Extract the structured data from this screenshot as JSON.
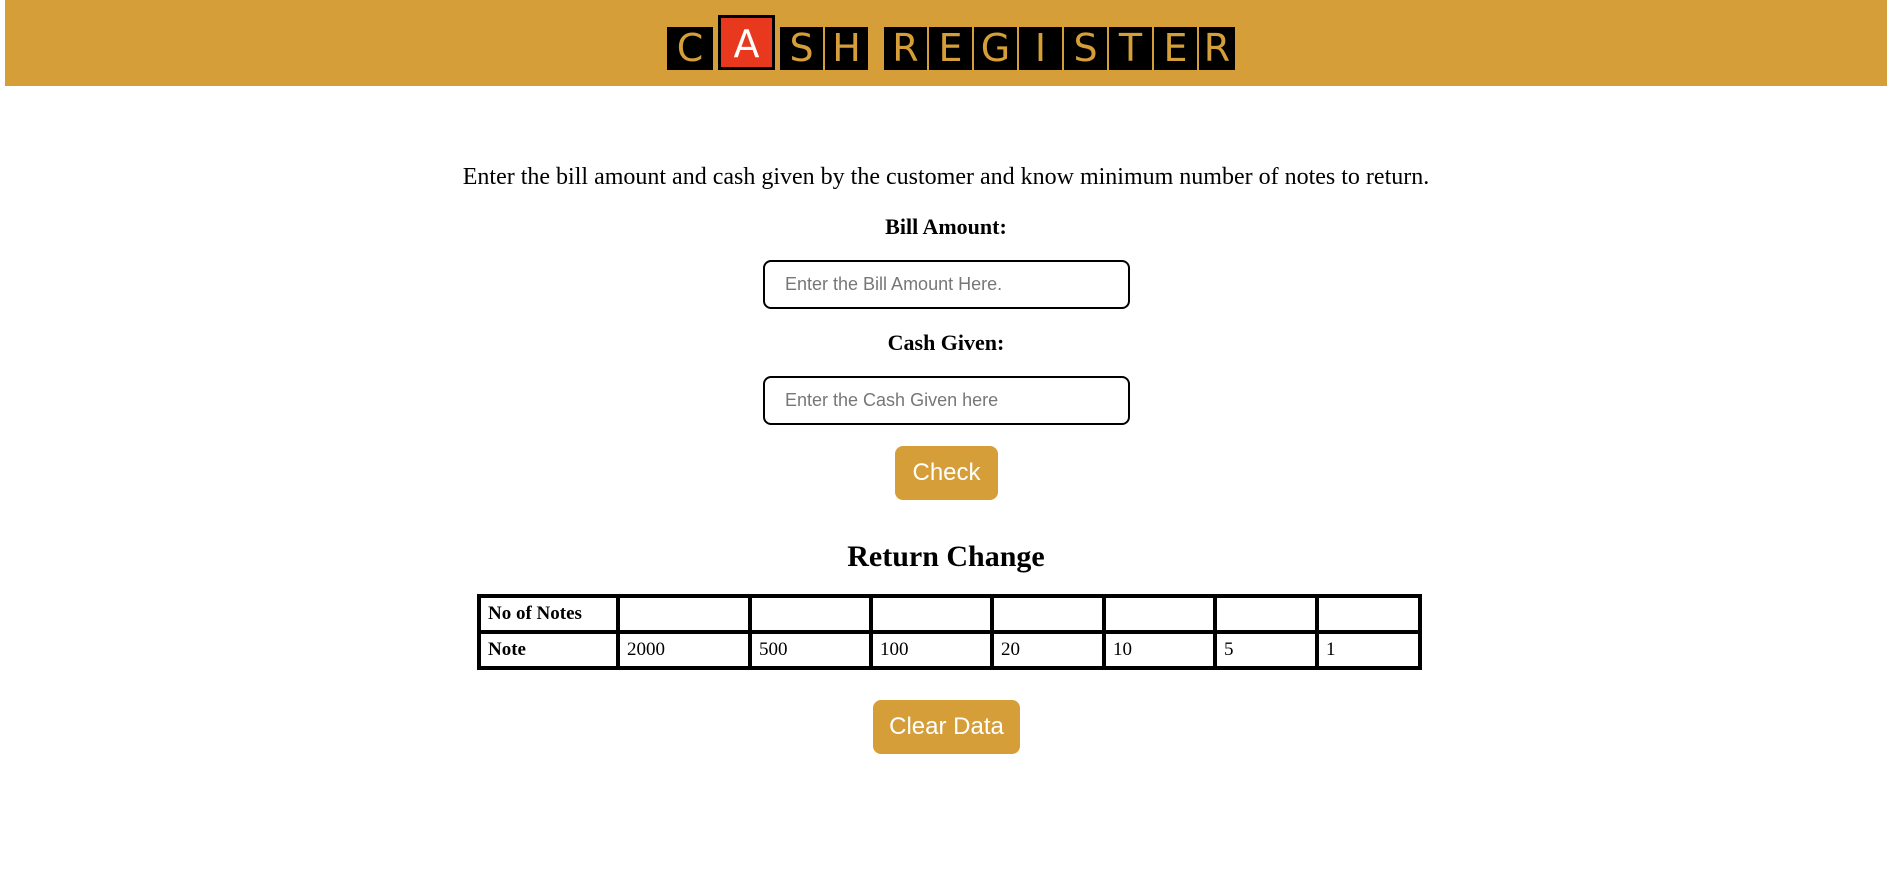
{
  "header": {
    "logo_letters": [
      "C",
      "A",
      "S",
      "H",
      "R",
      "E",
      "G",
      "I",
      "S",
      "T",
      "E",
      "R"
    ],
    "colors": {
      "bar": "#d59e38",
      "tile": "#000000",
      "highlight": "#e8381e"
    }
  },
  "intro_text": "Enter the bill amount and cash given by the customer and know minimum number of notes to return.",
  "bill": {
    "label": "Bill Amount:",
    "placeholder": "Enter the Bill Amount Here.",
    "value": ""
  },
  "cash": {
    "label": "Cash Given:",
    "placeholder": "Enter the Cash Given here",
    "value": ""
  },
  "check_label": "Check",
  "return_title": "Return Change",
  "table": {
    "rows": [
      {
        "header": "No of Notes",
        "cells": [
          "",
          "",
          "",
          "",
          "",
          "",
          ""
        ]
      },
      {
        "header": "Note",
        "cells": [
          "2000",
          "500",
          "100",
          "20",
          "10",
          "5",
          "1"
        ]
      }
    ]
  },
  "clear_label": "Clear Data"
}
